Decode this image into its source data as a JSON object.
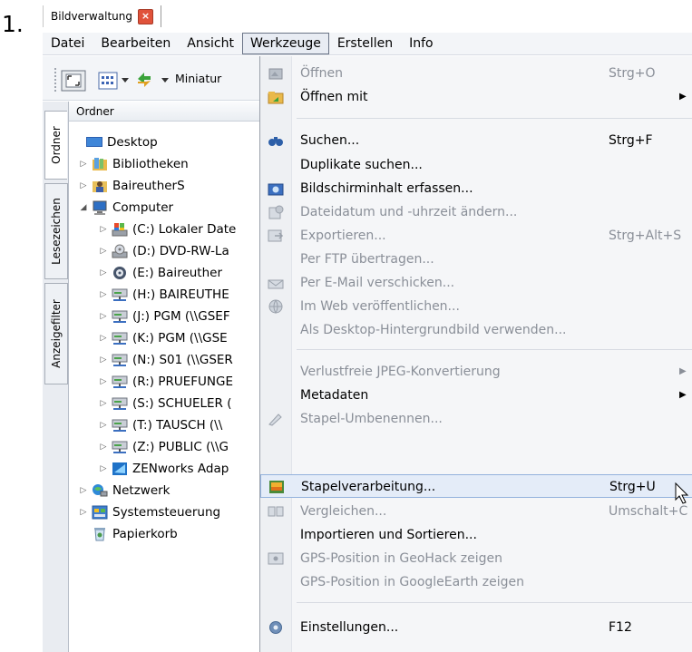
{
  "step_number": "1.",
  "document_tab": {
    "label": "Bildverwaltung",
    "close_glyph": "×"
  },
  "menubar": [
    "Datei",
    "Bearbeiten",
    "Ansicht",
    "Werkzeuge",
    "Erstellen",
    "Info"
  ],
  "toolbar": {
    "miniatur_label": "Miniatur"
  },
  "vertical_tabs": [
    "Ordner",
    "Lesezeichen",
    "Anzeigefilter"
  ],
  "tree": {
    "header": "Ordner",
    "nodes": [
      {
        "label": "Desktop",
        "icon": "desktop-icon"
      },
      {
        "label": "Bibliotheken",
        "icon": "library-icon"
      },
      {
        "label": "BaireutherS",
        "icon": "user-folder-icon"
      },
      {
        "label": "Computer",
        "icon": "computer-icon"
      },
      {
        "label": "(C:) Lokaler Date",
        "icon": "local-drive-icon"
      },
      {
        "label": "(D:) DVD-RW-La",
        "icon": "dvd-drive-icon"
      },
      {
        "label": "(E:) Baireuther",
        "icon": "disc-icon"
      },
      {
        "label": "(H:) BAIREUTHE",
        "icon": "network-drive-icon"
      },
      {
        "label": "(J:) PGM (\\\\GSEF",
        "icon": "network-drive-icon"
      },
      {
        "label": "(K:) PGM (\\\\GSE",
        "icon": "network-drive-icon"
      },
      {
        "label": "(N:) S01 (\\\\GSER",
        "icon": "network-drive-icon"
      },
      {
        "label": "(R:) PRUEFUNGE",
        "icon": "network-drive-icon"
      },
      {
        "label": "(S:) SCHUELER (",
        "icon": "network-drive-icon"
      },
      {
        "label": "(T:) TAUSCH (\\\\",
        "icon": "network-drive-icon"
      },
      {
        "label": "(Z:) PUBLIC (\\\\G",
        "icon": "network-drive-icon"
      },
      {
        "label": "ZENworks Adap",
        "icon": "zenworks-icon"
      },
      {
        "label": "Netzwerk",
        "icon": "network-icon"
      },
      {
        "label": "Systemsteuerung",
        "icon": "control-panel-icon"
      },
      {
        "label": "Papierkorb",
        "icon": "recycle-bin-icon"
      }
    ]
  },
  "menu": {
    "items": [
      {
        "label": "Öffnen",
        "shortcut": "Strg+O",
        "disabled": true,
        "submenu": false,
        "icon": "open-icon"
      },
      {
        "label": "Öffnen mit",
        "shortcut": "",
        "disabled": false,
        "submenu": true,
        "icon": "open-with-icon"
      },
      {
        "label": "Suchen...",
        "shortcut": "Strg+F",
        "disabled": false,
        "submenu": false,
        "icon": "binoculars-icon"
      },
      {
        "label": "Duplikate suchen...",
        "shortcut": "",
        "disabled": false,
        "submenu": false,
        "icon": ""
      },
      {
        "label": "Bildschirminhalt erfassen...",
        "shortcut": "",
        "disabled": false,
        "submenu": false,
        "icon": "camera-icon"
      },
      {
        "label": "Dateidatum und -uhrzeit ändern...",
        "shortcut": "",
        "disabled": true,
        "submenu": false,
        "icon": "calendar-icon"
      },
      {
        "label": "Exportieren...",
        "shortcut": "Strg+Alt+S",
        "disabled": true,
        "submenu": false,
        "icon": "export-icon"
      },
      {
        "label": "Per FTP übertragen...",
        "shortcut": "",
        "disabled": true,
        "submenu": false,
        "icon": ""
      },
      {
        "label": "Per E-Mail verschicken...",
        "shortcut": "",
        "disabled": true,
        "submenu": false,
        "icon": "email-icon"
      },
      {
        "label": "Im Web veröffentlichen...",
        "shortcut": "",
        "disabled": true,
        "submenu": false,
        "icon": "globe-icon"
      },
      {
        "label": "Als Desktop-Hintergrundbild verwenden...",
        "shortcut": "",
        "disabled": true,
        "submenu": false,
        "icon": ""
      },
      {
        "label": "Verlustfreie JPEG-Konvertierung",
        "shortcut": "",
        "disabled": true,
        "submenu": true,
        "icon": ""
      },
      {
        "label": "Metadaten",
        "shortcut": "",
        "disabled": false,
        "submenu": true,
        "icon": ""
      },
      {
        "label": "Stapel-Umbenennen...",
        "shortcut": "",
        "disabled": true,
        "submenu": false,
        "icon": "rename-icon"
      },
      {
        "label": "Stapelverarbeitung...",
        "shortcut": "Strg+U",
        "disabled": false,
        "submenu": false,
        "icon": "batch-icon",
        "highlighted": true
      },
      {
        "label": "Vergleichen...",
        "shortcut": "Umschalt+C",
        "disabled": true,
        "submenu": false,
        "icon": "compare-icon"
      },
      {
        "label": "Importieren und Sortieren...",
        "shortcut": "",
        "disabled": false,
        "submenu": false,
        "icon": ""
      },
      {
        "label": "GPS-Position in GeoHack zeigen",
        "shortcut": "",
        "disabled": true,
        "submenu": false,
        "icon": "gps-icon"
      },
      {
        "label": "GPS-Position in GoogleEarth zeigen",
        "shortcut": "",
        "disabled": true,
        "submenu": false,
        "icon": ""
      },
      {
        "label": "Einstellungen...",
        "shortcut": "F12",
        "disabled": false,
        "submenu": false,
        "icon": "gear-icon"
      }
    ],
    "submenu_arrow": "▶"
  },
  "colors": {
    "highlight": "#e4ecf8",
    "disabled_text": "#8a8f98",
    "menu_bg": "#f5f6f8"
  }
}
